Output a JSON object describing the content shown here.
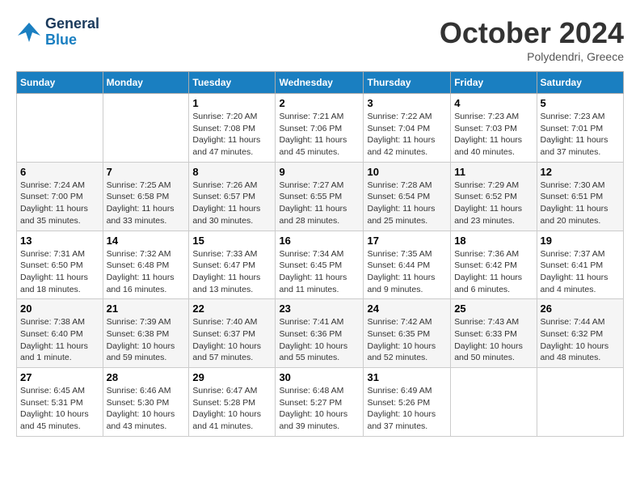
{
  "header": {
    "logo_line1": "General",
    "logo_line2": "Blue",
    "month": "October 2024",
    "location": "Polydendri, Greece"
  },
  "weekdays": [
    "Sunday",
    "Monday",
    "Tuesday",
    "Wednesday",
    "Thursday",
    "Friday",
    "Saturday"
  ],
  "weeks": [
    [
      {
        "day": "",
        "info": ""
      },
      {
        "day": "",
        "info": ""
      },
      {
        "day": "1",
        "info": "Sunrise: 7:20 AM\nSunset: 7:08 PM\nDaylight: 11 hours and 47 minutes."
      },
      {
        "day": "2",
        "info": "Sunrise: 7:21 AM\nSunset: 7:06 PM\nDaylight: 11 hours and 45 minutes."
      },
      {
        "day": "3",
        "info": "Sunrise: 7:22 AM\nSunset: 7:04 PM\nDaylight: 11 hours and 42 minutes."
      },
      {
        "day": "4",
        "info": "Sunrise: 7:23 AM\nSunset: 7:03 PM\nDaylight: 11 hours and 40 minutes."
      },
      {
        "day": "5",
        "info": "Sunrise: 7:23 AM\nSunset: 7:01 PM\nDaylight: 11 hours and 37 minutes."
      }
    ],
    [
      {
        "day": "6",
        "info": "Sunrise: 7:24 AM\nSunset: 7:00 PM\nDaylight: 11 hours and 35 minutes."
      },
      {
        "day": "7",
        "info": "Sunrise: 7:25 AM\nSunset: 6:58 PM\nDaylight: 11 hours and 33 minutes."
      },
      {
        "day": "8",
        "info": "Sunrise: 7:26 AM\nSunset: 6:57 PM\nDaylight: 11 hours and 30 minutes."
      },
      {
        "day": "9",
        "info": "Sunrise: 7:27 AM\nSunset: 6:55 PM\nDaylight: 11 hours and 28 minutes."
      },
      {
        "day": "10",
        "info": "Sunrise: 7:28 AM\nSunset: 6:54 PM\nDaylight: 11 hours and 25 minutes."
      },
      {
        "day": "11",
        "info": "Sunrise: 7:29 AM\nSunset: 6:52 PM\nDaylight: 11 hours and 23 minutes."
      },
      {
        "day": "12",
        "info": "Sunrise: 7:30 AM\nSunset: 6:51 PM\nDaylight: 11 hours and 20 minutes."
      }
    ],
    [
      {
        "day": "13",
        "info": "Sunrise: 7:31 AM\nSunset: 6:50 PM\nDaylight: 11 hours and 18 minutes."
      },
      {
        "day": "14",
        "info": "Sunrise: 7:32 AM\nSunset: 6:48 PM\nDaylight: 11 hours and 16 minutes."
      },
      {
        "day": "15",
        "info": "Sunrise: 7:33 AM\nSunset: 6:47 PM\nDaylight: 11 hours and 13 minutes."
      },
      {
        "day": "16",
        "info": "Sunrise: 7:34 AM\nSunset: 6:45 PM\nDaylight: 11 hours and 11 minutes."
      },
      {
        "day": "17",
        "info": "Sunrise: 7:35 AM\nSunset: 6:44 PM\nDaylight: 11 hours and 9 minutes."
      },
      {
        "day": "18",
        "info": "Sunrise: 7:36 AM\nSunset: 6:42 PM\nDaylight: 11 hours and 6 minutes."
      },
      {
        "day": "19",
        "info": "Sunrise: 7:37 AM\nSunset: 6:41 PM\nDaylight: 11 hours and 4 minutes."
      }
    ],
    [
      {
        "day": "20",
        "info": "Sunrise: 7:38 AM\nSunset: 6:40 PM\nDaylight: 11 hours and 1 minute."
      },
      {
        "day": "21",
        "info": "Sunrise: 7:39 AM\nSunset: 6:38 PM\nDaylight: 10 hours and 59 minutes."
      },
      {
        "day": "22",
        "info": "Sunrise: 7:40 AM\nSunset: 6:37 PM\nDaylight: 10 hours and 57 minutes."
      },
      {
        "day": "23",
        "info": "Sunrise: 7:41 AM\nSunset: 6:36 PM\nDaylight: 10 hours and 55 minutes."
      },
      {
        "day": "24",
        "info": "Sunrise: 7:42 AM\nSunset: 6:35 PM\nDaylight: 10 hours and 52 minutes."
      },
      {
        "day": "25",
        "info": "Sunrise: 7:43 AM\nSunset: 6:33 PM\nDaylight: 10 hours and 50 minutes."
      },
      {
        "day": "26",
        "info": "Sunrise: 7:44 AM\nSunset: 6:32 PM\nDaylight: 10 hours and 48 minutes."
      }
    ],
    [
      {
        "day": "27",
        "info": "Sunrise: 6:45 AM\nSunset: 5:31 PM\nDaylight: 10 hours and 45 minutes."
      },
      {
        "day": "28",
        "info": "Sunrise: 6:46 AM\nSunset: 5:30 PM\nDaylight: 10 hours and 43 minutes."
      },
      {
        "day": "29",
        "info": "Sunrise: 6:47 AM\nSunset: 5:28 PM\nDaylight: 10 hours and 41 minutes."
      },
      {
        "day": "30",
        "info": "Sunrise: 6:48 AM\nSunset: 5:27 PM\nDaylight: 10 hours and 39 minutes."
      },
      {
        "day": "31",
        "info": "Sunrise: 6:49 AM\nSunset: 5:26 PM\nDaylight: 10 hours and 37 minutes."
      },
      {
        "day": "",
        "info": ""
      },
      {
        "day": "",
        "info": ""
      }
    ]
  ]
}
